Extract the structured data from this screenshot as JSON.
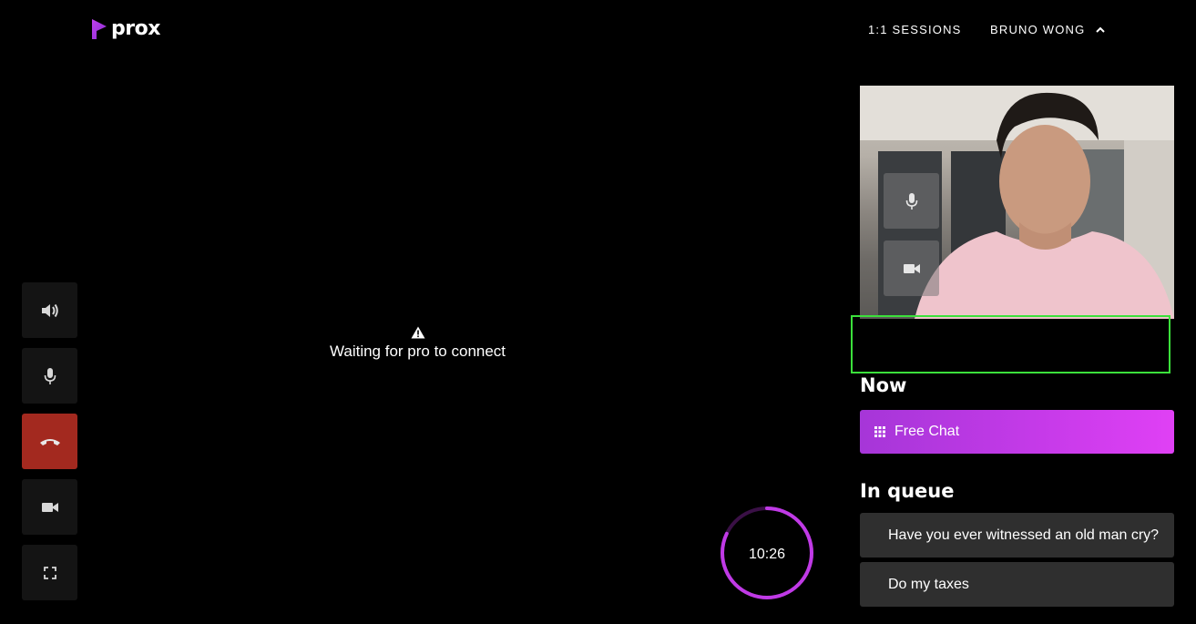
{
  "brand": {
    "name": "prox",
    "accent": "#b83ae0"
  },
  "header": {
    "sessions_label": "1:1 SESSIONS",
    "user_label": "BRUNO WONG"
  },
  "controls": [
    {
      "icon": "speaker-icon"
    },
    {
      "icon": "microphone-icon"
    },
    {
      "icon": "hangup-icon"
    },
    {
      "icon": "camera-icon"
    },
    {
      "icon": "fullscreen-icon"
    }
  ],
  "main": {
    "waiting_text": "Waiting for pro to connect"
  },
  "timer": {
    "text": "10:26",
    "progress": 0.82
  },
  "queue": {
    "now_title": "Now",
    "now_item": "Free Chat",
    "in_queue_title": "In queue",
    "items": [
      {
        "label": "Have you ever witnessed an old man cry?"
      },
      {
        "label": "Do my taxes"
      }
    ]
  }
}
